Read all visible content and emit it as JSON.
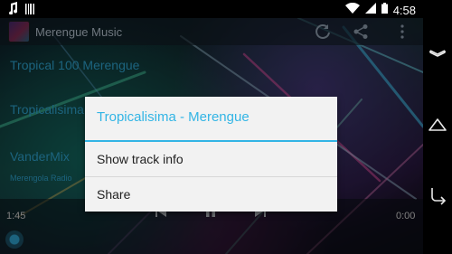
{
  "status_bar": {
    "time": "4:58",
    "icons": [
      "music-note-icon",
      "barcode-icon",
      "wifi-icon",
      "signal-icon",
      "battery-icon"
    ]
  },
  "action_bar": {
    "title": "Merengue Music",
    "icons": [
      "refresh-icon",
      "share-icon",
      "overflow-menu-icon"
    ]
  },
  "list": {
    "items": [
      {
        "title": "Tropical 100 Merengue"
      },
      {
        "title": "Tropicalisima"
      },
      {
        "title": "VanderMix",
        "subtitle": "Merengola Radio"
      }
    ]
  },
  "player": {
    "elapsed": "1:45",
    "remaining": "0:00",
    "controls": [
      "previous-icon",
      "pause-icon",
      "next-icon"
    ]
  },
  "dialog": {
    "title": "Tropicalisima - Merengue",
    "options": [
      "Show track info",
      "Share"
    ]
  },
  "colors": {
    "accent": "#33b5e5",
    "dialog_bg": "#f2f2f2",
    "dialog_text": "#222222"
  }
}
